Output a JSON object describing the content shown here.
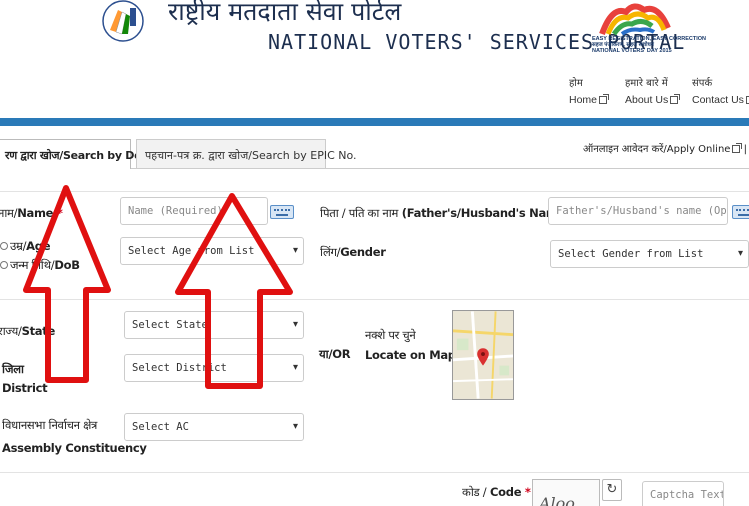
{
  "header": {
    "title_hi": "राष्ट्रीय मतदाता सेवा पोर्टल",
    "title_en": "NATIONAL VOTERS' SERVICES PORTAL",
    "logo_right_lines": [
      "EASY REGISTRATION, EASY CORRECTION",
      "सहज पंजीकरण, सहज संशोधन",
      "NATIONAL VOTERS' DAY 2015"
    ]
  },
  "toplinks": [
    {
      "hi": "होम",
      "en": "Home"
    },
    {
      "hi": "हमारे बारे में",
      "en": "About Us"
    },
    {
      "hi": "संपर्क",
      "en": "Contact Us"
    }
  ],
  "tabs": {
    "details": "रण द्वारा खोज/Search by Details",
    "epic": "पहचान-पत्र क्र. द्वारा खोज/Search by EPIC No.",
    "apply_online": "ऑनलाइन आवेदन करें/Apply Online"
  },
  "form": {
    "name_label_hi": "नाम/",
    "name_label_en": "Name",
    "name_placeholder": "Name (Required)",
    "father_label_hi": "पिता / पति का नाम",
    "father_label_en": "(Father's/Husband's Name)",
    "father_placeholder": "Father's/Husband's name (Optional)",
    "age_label_hi": "उम्र/",
    "age_label_en": "Age",
    "dob_label_hi": "जन्म तिथि/",
    "dob_label_en": "DoB",
    "age_select": "Select Age from List",
    "gender_label_hi": "लिंग/",
    "gender_label_en": "Gender",
    "gender_select": "Select Gender from List",
    "state_label_hi": "राज्य/",
    "state_label_en": "State",
    "state_select": "Select State",
    "district_label_hi": "जिला",
    "district_label_en": "District",
    "district_select": "Select District",
    "or_label": "या/OR",
    "map_label_hi": "नक्शे पर चुने",
    "map_label_en": "Locate on Map",
    "ac_label_hi": "विधानसभा निर्वाचन क्षेत्र",
    "ac_label_en": "Assembly Constituency",
    "ac_select": "Select AC",
    "code_label_hi": "कोड /",
    "code_label_en": "Code",
    "captcha_placeholder": "Captcha Text",
    "captcha_partial": "Aloo"
  },
  "colors": {
    "accent_bar": "#2a7ab8",
    "arrow": "#e01010",
    "required": "#d0021b"
  }
}
